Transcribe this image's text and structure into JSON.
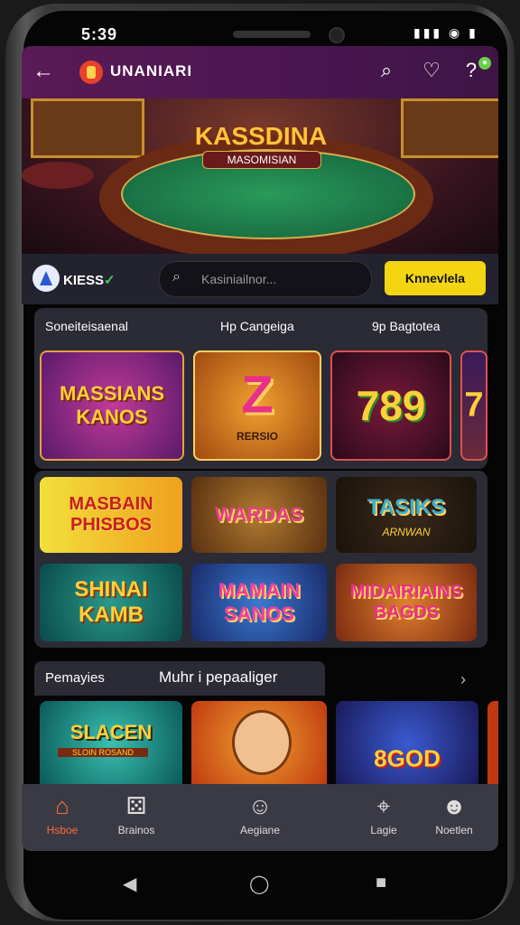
{
  "status_bar": {
    "time": "5:39",
    "icons": "▮▮▮ ◉ ▮"
  },
  "app_bar": {
    "title": "UNANIARI"
  },
  "hero": {
    "headline": "KASSDINA",
    "subheadline": "MASOMISIAN"
  },
  "toolbar": {
    "brand": "KIESS",
    "brand_mark": "✓",
    "search_placeholder": "Kasiniailnor...",
    "cta_label": "Knnevlela"
  },
  "sections": {
    "label_1": "Soneiteisaenal",
    "label_2": "Hp Cangeiga",
    "label_3": "9p Bagtotea",
    "footer_label_1": "Pemayies",
    "footer_label_2": "Muhr i pepaaliger"
  },
  "featured_tiles": [
    {
      "title": "MASSIANS KANOS"
    },
    {
      "title": "Z",
      "subtitle": "RERSIO"
    },
    {
      "title": "789"
    },
    {
      "title": "7"
    }
  ],
  "grid_tiles": [
    {
      "title": "MASBAIN PHISBOS"
    },
    {
      "title": "WARDAS"
    },
    {
      "title": "TASIKS",
      "subtitle": "ARNWAN"
    },
    {
      "title": "SHINAI KAMB"
    },
    {
      "title": "MAMAIN SANOS"
    },
    {
      "title": "MIDAIRIAINS BAGDS"
    }
  ],
  "bottom_tiles": [
    {
      "title": "SLACEN",
      "subtitle": "SLOIN ROSAND"
    },
    {
      "title": ""
    },
    {
      "title": "8GOD"
    }
  ],
  "bottom_nav": [
    {
      "label": "Hsboe",
      "icon": "home-icon"
    },
    {
      "label": "Brainos",
      "icon": "dice-icon"
    },
    {
      "label": "Aegiane",
      "icon": "avatar-icon"
    },
    {
      "label": "Lagie",
      "icon": "gamepad-icon"
    },
    {
      "label": "Noetlen",
      "icon": "user-icon"
    }
  ],
  "colors": {
    "accent": "#f4d512",
    "appbar": "#4a1650",
    "panel": "#2b2b36",
    "active_nav": "#ff6a3a"
  }
}
